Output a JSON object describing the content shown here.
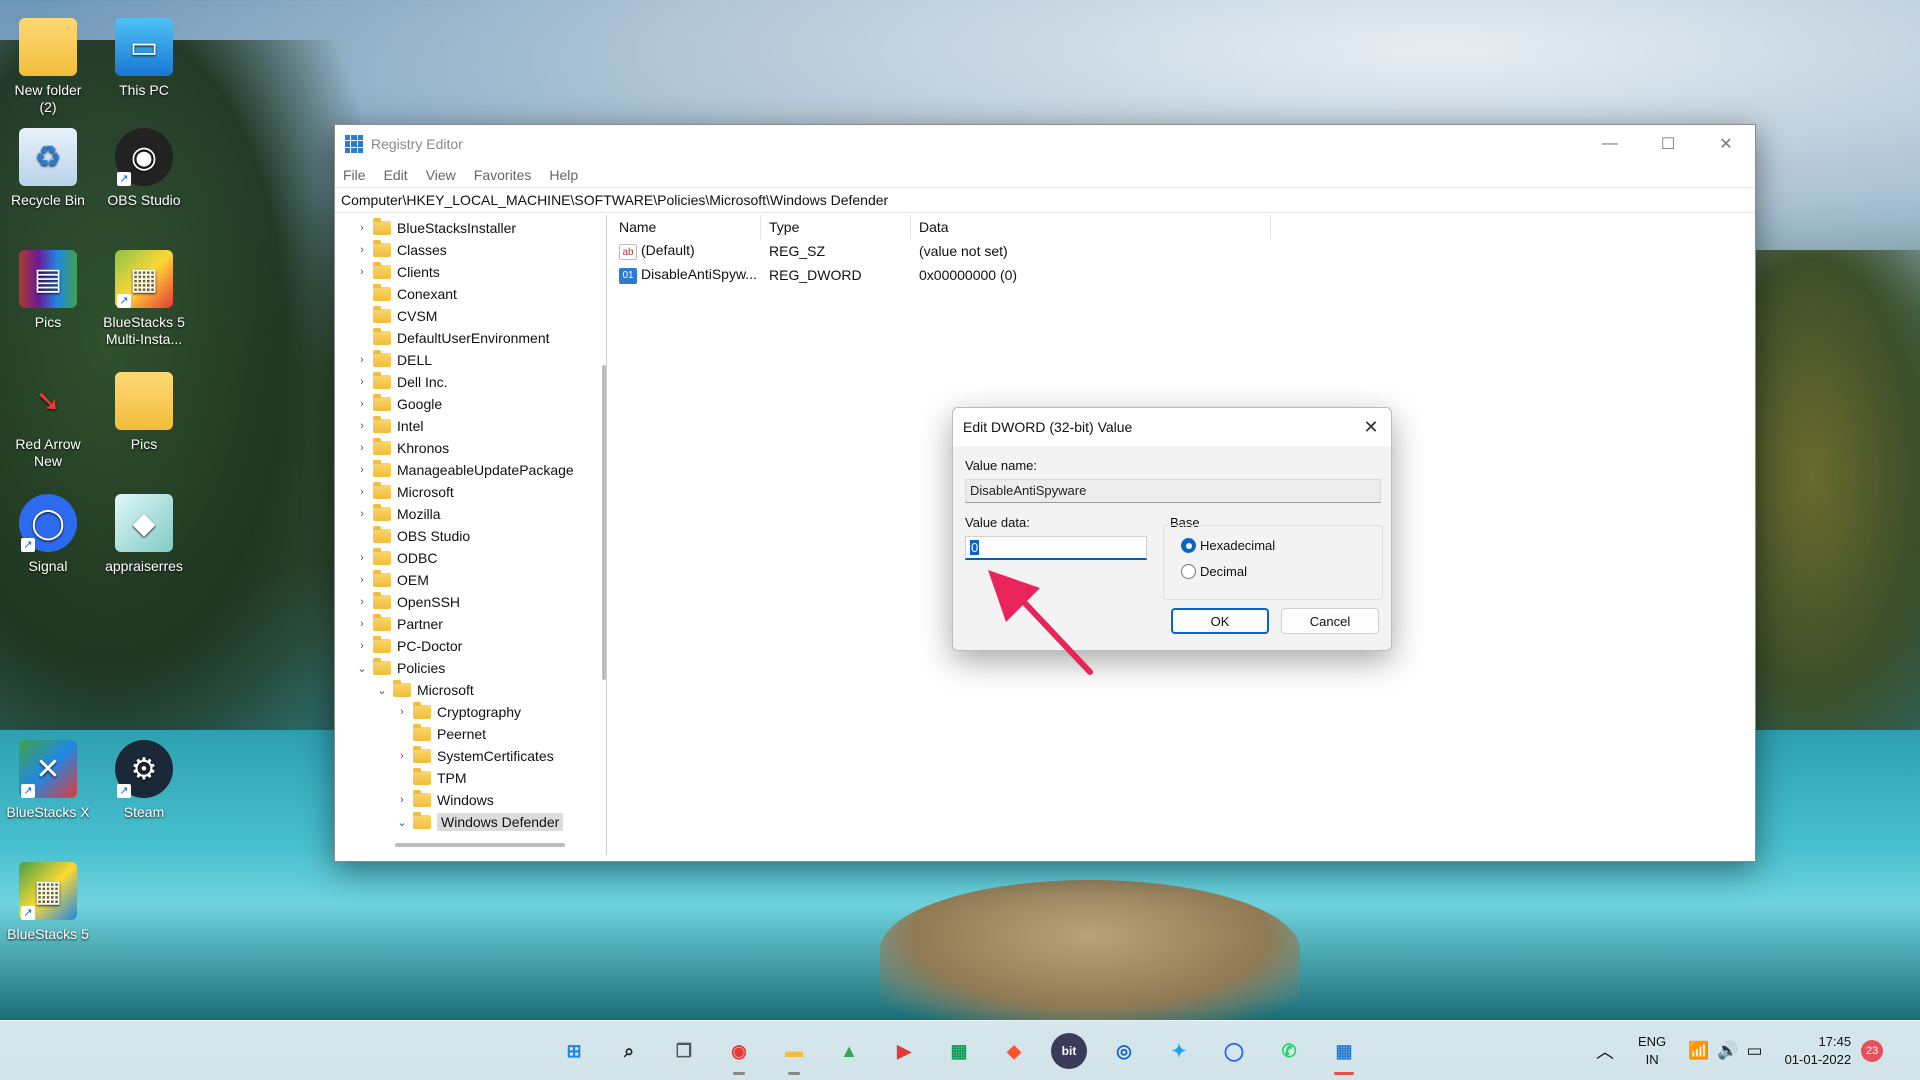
{
  "desktop": {
    "icons": [
      {
        "label": "New folder\n(2)",
        "icon": "folder-icon"
      },
      {
        "label": "This PC",
        "icon": "monitor-icon"
      },
      {
        "label": "Recycle Bin",
        "icon": "recycle-bin-icon"
      },
      {
        "label": "OBS Studio",
        "icon": "obs-icon"
      },
      {
        "label": "Pics",
        "icon": "winrar-icon"
      },
      {
        "label": "BlueStacks 5\nMulti-Insta...",
        "icon": "bluestacks-multi-icon"
      },
      {
        "label": "Red Arrow\nNew",
        "icon": "red-arrow-icon"
      },
      {
        "label": "Pics",
        "icon": "folder-icon"
      },
      {
        "label": "Signal",
        "icon": "signal-icon"
      },
      {
        "label": "appraiserres",
        "icon": "file-icon"
      },
      {
        "label": "BlueStacks X",
        "icon": "bluestacks-x-icon"
      },
      {
        "label": "Steam",
        "icon": "steam-icon"
      },
      {
        "label": "BlueStacks 5",
        "icon": "bluestacks-icon"
      }
    ]
  },
  "window": {
    "title": "Registry Editor",
    "controls": {
      "minimize": "—",
      "maximize": "☐",
      "close": "✕"
    },
    "menu": [
      "File",
      "Edit",
      "View",
      "Favorites",
      "Help"
    ],
    "address": "Computer\\HKEY_LOCAL_MACHINE\\SOFTWARE\\Policies\\Microsoft\\Windows Defender"
  },
  "tree": [
    {
      "label": "BlueStacksInstaller",
      "indent": 0,
      "chevron": ">"
    },
    {
      "label": "Classes",
      "indent": 0,
      "chevron": ">"
    },
    {
      "label": "Clients",
      "indent": 0,
      "chevron": ">"
    },
    {
      "label": "Conexant",
      "indent": 0,
      "chevron": ""
    },
    {
      "label": "CVSM",
      "indent": 0,
      "chevron": ""
    },
    {
      "label": "DefaultUserEnvironment",
      "indent": 0,
      "chevron": ""
    },
    {
      "label": "DELL",
      "indent": 0,
      "chevron": ">"
    },
    {
      "label": "Dell Inc.",
      "indent": 0,
      "chevron": ">"
    },
    {
      "label": "Google",
      "indent": 0,
      "chevron": ">"
    },
    {
      "label": "Intel",
      "indent": 0,
      "chevron": ">"
    },
    {
      "label": "Khronos",
      "indent": 0,
      "chevron": ">"
    },
    {
      "label": "ManageableUpdatePackage",
      "indent": 0,
      "chevron": ">"
    },
    {
      "label": "Microsoft",
      "indent": 0,
      "chevron": ">"
    },
    {
      "label": "Mozilla",
      "indent": 0,
      "chevron": ">"
    },
    {
      "label": "OBS Studio",
      "indent": 0,
      "chevron": ""
    },
    {
      "label": "ODBC",
      "indent": 0,
      "chevron": ">"
    },
    {
      "label": "OEM",
      "indent": 0,
      "chevron": ">"
    },
    {
      "label": "OpenSSH",
      "indent": 0,
      "chevron": ">"
    },
    {
      "label": "Partner",
      "indent": 0,
      "chevron": ">"
    },
    {
      "label": "PC-Doctor",
      "indent": 0,
      "chevron": ">"
    },
    {
      "label": "Policies",
      "indent": 0,
      "chevron": "v"
    },
    {
      "label": "Microsoft",
      "indent": 1,
      "chevron": "v"
    },
    {
      "label": "Cryptography",
      "indent": 2,
      "chevron": ">"
    },
    {
      "label": "Peernet",
      "indent": 2,
      "chevron": ""
    },
    {
      "label": "SystemCertificates",
      "indent": 2,
      "chevron": ">"
    },
    {
      "label": "TPM",
      "indent": 2,
      "chevron": ""
    },
    {
      "label": "Windows",
      "indent": 2,
      "chevron": ">"
    },
    {
      "label": "Windows Defender",
      "indent": 2,
      "chevron": "v",
      "selected": true
    }
  ],
  "values": {
    "columns": [
      "Name",
      "Type",
      "Data"
    ],
    "rows": [
      {
        "name": "(Default)",
        "type": "REG_SZ",
        "data": "(value not set)",
        "icon": "ab"
      },
      {
        "name": "DisableAntiSpyw...",
        "type": "REG_DWORD",
        "data": "0x00000000 (0)",
        "icon": "01"
      }
    ]
  },
  "dialog": {
    "title": "Edit DWORD (32-bit) Value",
    "value_name_label": "Value name:",
    "value_name": "DisableAntiSpyware",
    "value_data_label": "Value data:",
    "value_data": "0",
    "base_label": "Base",
    "hex_label": "Hexadecimal",
    "dec_label": "Decimal",
    "selected_base": "Hexadecimal",
    "ok_label": "OK",
    "cancel_label": "Cancel",
    "close": "✕"
  },
  "taskbar": {
    "apps": [
      {
        "icon": "start-icon"
      },
      {
        "icon": "search-icon"
      },
      {
        "icon": "task-view-icon"
      },
      {
        "icon": "chrome-icon"
      },
      {
        "icon": "file-explorer-icon"
      },
      {
        "icon": "google-drive-icon"
      },
      {
        "icon": "youtube-icon"
      },
      {
        "icon": "google-sheets-icon"
      },
      {
        "icon": "brave-icon"
      },
      {
        "icon": "bit-icon",
        "text": "bit"
      },
      {
        "icon": "cortana-icon"
      },
      {
        "icon": "twitter-icon"
      },
      {
        "icon": "signal-icon"
      },
      {
        "icon": "whatsapp-icon"
      },
      {
        "icon": "registry-editor-icon"
      }
    ],
    "tray": {
      "lang_top": "ENG",
      "lang_bottom": "IN",
      "time": "17:45",
      "date": "01-01-2022",
      "notifications": "23"
    }
  },
  "colors": {
    "accent": "#0a64c8",
    "arrow": "#e8245a",
    "folder": "#f2bd3b"
  }
}
